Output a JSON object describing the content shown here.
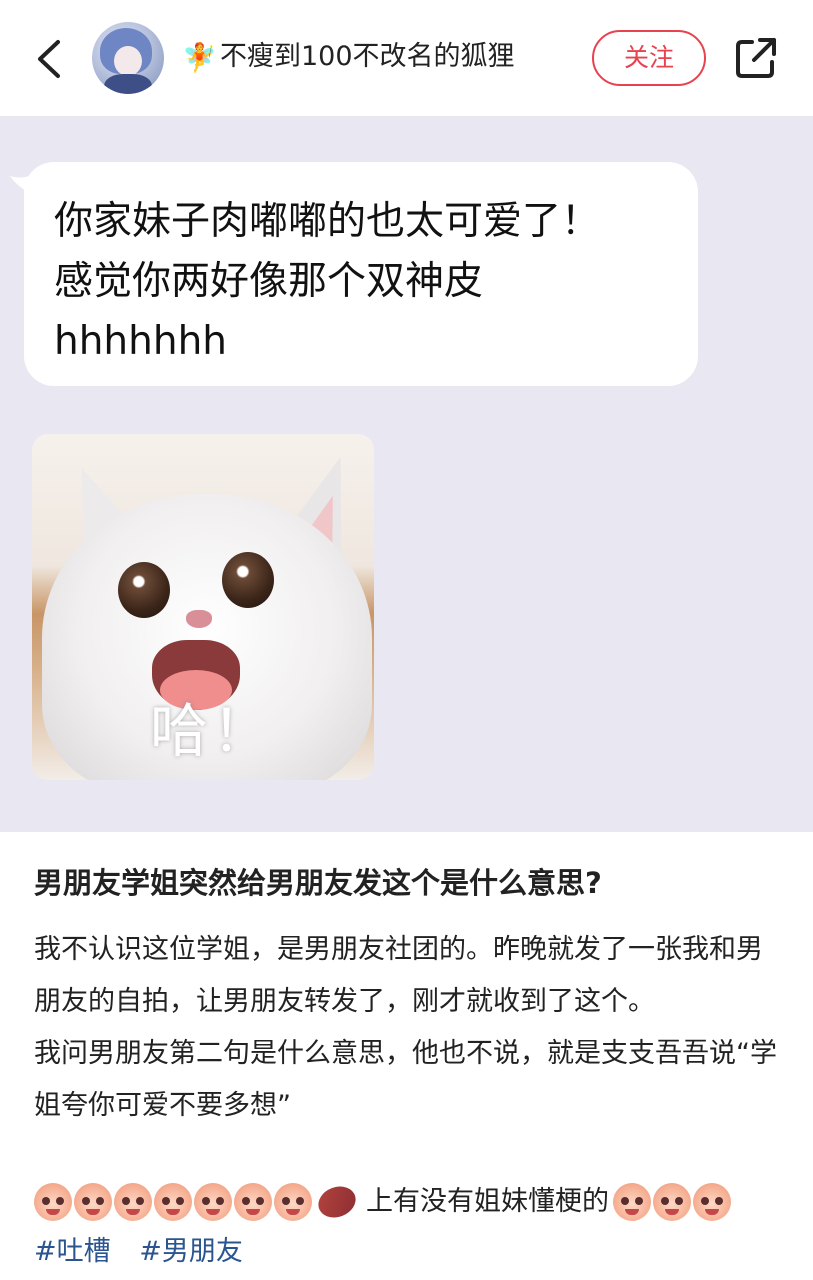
{
  "header": {
    "username": "不瘦到100不改名的狐狸",
    "follow_label": "关注",
    "fairy_icon": "🧚"
  },
  "image": {
    "bubble_text": "你家妹子肉嘟嘟的也太可爱了！\n感觉你两好像那个双神皮\nhhhhhhh",
    "cat_caption": "哈！"
  },
  "post": {
    "title": "男朋友学姐突然给男朋友发这个是什么意思?",
    "paragraphs": [
      "我不认识这位学姐，是男朋友社团的。昨晚就发了一张我和男朋友的自拍，让男朋友转发了，刚才就收到了这个。",
      "我问男朋友第二句是什么意思，他也不说，就是支支吾吾说“学姐夸你可爱不要多想”"
    ],
    "emoji_line_text": "上有没有姐妹懂梗的",
    "tags": [
      "#吐槽",
      "#男朋友"
    ]
  },
  "colors": {
    "accent": "#e8424f",
    "tag": "#2b5590",
    "image_bg": "#e9e8f2"
  }
}
